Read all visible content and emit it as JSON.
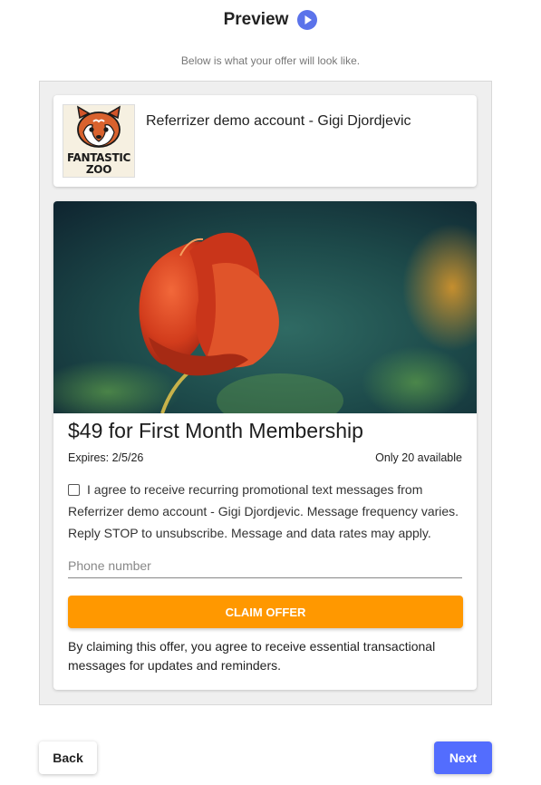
{
  "header": {
    "title": "Preview",
    "play_icon": "play-circle-icon",
    "subtitle": "Below is what your offer will look like.",
    "accent_color": "#5b73ea"
  },
  "business": {
    "name": "Referrizer demo account - Gigi Djordjevic",
    "logo_text_line1": "FANTASTIC",
    "logo_text_line2": "ZOO"
  },
  "offer": {
    "image": "red-tulip-photo",
    "title": "$49 for First Month Membership",
    "expires": "Expires: 2/5/26",
    "availability": "Only 20 available",
    "consent_text": "I agree to receive recurring promotional text messages from Referrizer demo account - Gigi Djordjevic. Message frequency varies. Reply STOP to unsubscribe. Message and data rates may apply.",
    "phone_placeholder": "Phone number",
    "phone_value": "",
    "claim_label": "CLAIM OFFER",
    "claim_color": "#ff9800",
    "claim_note": "By claiming this offer, you agree to receive essential transactional messages for updates and reminders."
  },
  "footer": {
    "back_label": "Back",
    "next_label": "Next",
    "next_color": "#536dfe"
  }
}
